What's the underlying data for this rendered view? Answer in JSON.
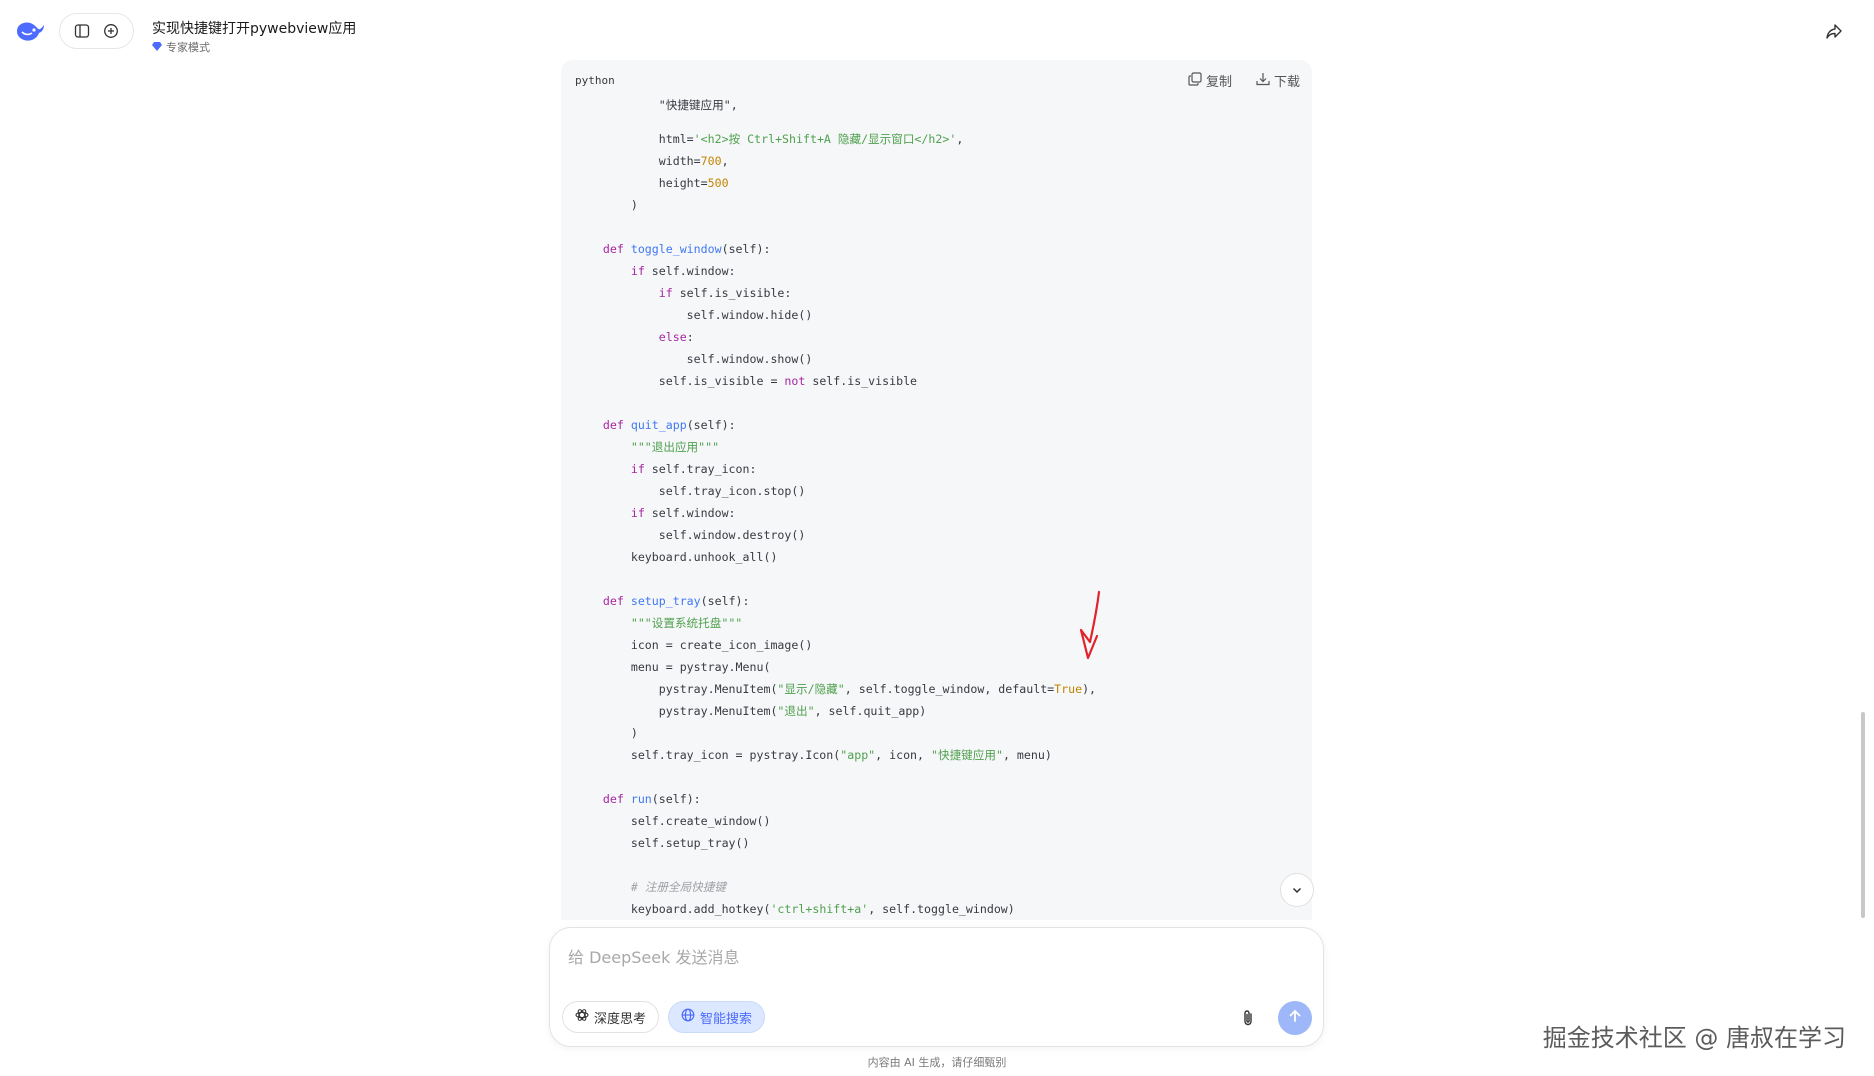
{
  "header": {
    "title": "实现快捷键打开pywebview应用",
    "mode_label": "专家模式"
  },
  "code_block": {
    "language": "python",
    "copy_label": "复制",
    "download_label": "下载",
    "lines": [
      [
        [
          "",
          "            \"快捷键应用\","
        ]
      ],
      [
        [
          "",
          "            html="
        ],
        [
          "st",
          "'<h2>按 Ctrl+Shift+A 隐藏/显示窗口</h2>'"
        ],
        [
          "",
          ","
        ]
      ],
      [
        [
          "",
          "            width="
        ],
        [
          "nm",
          "700"
        ],
        [
          "",
          ","
        ]
      ],
      [
        [
          "",
          "            height="
        ],
        [
          "nm",
          "500"
        ]
      ],
      [
        [
          "",
          "        )"
        ]
      ],
      [
        [
          "",
          ""
        ]
      ],
      [
        [
          "kw",
          "    def "
        ],
        [
          "fn",
          "toggle_window"
        ],
        [
          "",
          "(self):"
        ]
      ],
      [
        [
          "kw",
          "        if "
        ],
        [
          "",
          "self.window:"
        ]
      ],
      [
        [
          "kw",
          "            if "
        ],
        [
          "",
          "self.is_visible:"
        ]
      ],
      [
        [
          "",
          "                self.window.hide()"
        ]
      ],
      [
        [
          "kw",
          "            else"
        ],
        [
          "",
          ":"
        ]
      ],
      [
        [
          "",
          "                self.window.show()"
        ]
      ],
      [
        [
          "",
          "            self.is_visible = "
        ],
        [
          "kw",
          "not"
        ],
        [
          "",
          " self.is_visible"
        ]
      ],
      [
        [
          "",
          ""
        ]
      ],
      [
        [
          "kw",
          "    def "
        ],
        [
          "fn",
          "quit_app"
        ],
        [
          "",
          "(self):"
        ]
      ],
      [
        [
          "st",
          "        \"\"\"退出应用\"\"\""
        ]
      ],
      [
        [
          "kw",
          "        if "
        ],
        [
          "",
          "self.tray_icon:"
        ]
      ],
      [
        [
          "",
          "            self.tray_icon.stop()"
        ]
      ],
      [
        [
          "kw",
          "        if "
        ],
        [
          "",
          "self.window:"
        ]
      ],
      [
        [
          "",
          "            self.window.destroy()"
        ]
      ],
      [
        [
          "",
          "        keyboard.unhook_all()"
        ]
      ],
      [
        [
          "",
          ""
        ]
      ],
      [
        [
          "kw",
          "    def "
        ],
        [
          "fn",
          "setup_tray"
        ],
        [
          "",
          "(self):"
        ]
      ],
      [
        [
          "st",
          "        \"\"\"设置系统托盘\"\"\""
        ]
      ],
      [
        [
          "",
          "        icon = create_icon_image()"
        ]
      ],
      [
        [
          "",
          "        menu = pystray.Menu("
        ]
      ],
      [
        [
          "",
          "            pystray.MenuItem("
        ],
        [
          "st",
          "\"显示/隐藏\""
        ],
        [
          "",
          ", self.toggle_window, default="
        ],
        [
          "nm",
          "True"
        ],
        [
          "",
          "),"
        ]
      ],
      [
        [
          "",
          "            pystray.MenuItem("
        ],
        [
          "st",
          "\"退出\""
        ],
        [
          "",
          ", self.quit_app)"
        ]
      ],
      [
        [
          "",
          "        )"
        ]
      ],
      [
        [
          "",
          "        self.tray_icon = pystray.Icon("
        ],
        [
          "st",
          "\"app\""
        ],
        [
          "",
          ", icon, "
        ],
        [
          "st",
          "\"快捷键应用\""
        ],
        [
          "",
          ", menu)"
        ]
      ],
      [
        [
          "",
          ""
        ]
      ],
      [
        [
          "kw",
          "    def "
        ],
        [
          "fn",
          "run"
        ],
        [
          "",
          "(self):"
        ]
      ],
      [
        [
          "",
          "        self.create_window()"
        ]
      ],
      [
        [
          "",
          "        self.setup_tray()"
        ]
      ],
      [
        [
          "",
          ""
        ]
      ],
      [
        [
          "cm",
          "        # 注册全局快捷键"
        ]
      ],
      [
        [
          "",
          "        keyboard.add_hotkey("
        ],
        [
          "st",
          "'ctrl+shift+a'"
        ],
        [
          "",
          ", self.toggle_window)"
        ]
      ]
    ]
  },
  "composer": {
    "placeholder": "给 DeepSeek 发送消息",
    "deep_think_label": "深度思考",
    "search_label": "智能搜索"
  },
  "disclaimer": "内容由 AI 生成，请仔细甄别",
  "watermark": "掘金技术社区 @ 唐叔在学习",
  "colors": {
    "accent": "#4d6bfe",
    "send_button": "#9db7f9",
    "code_bg": "#f6f7f8",
    "annotation_arrow": "#e0242b"
  }
}
